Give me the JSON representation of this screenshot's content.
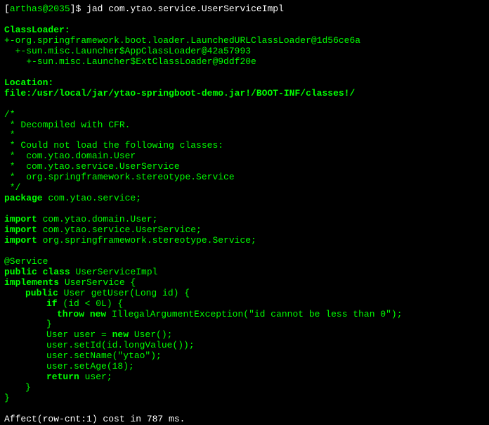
{
  "prompt": {
    "bracket_open": "[",
    "user_host": "arthas@2035",
    "bracket_close": "]$ ",
    "command": "jad com.ytao.service.UserServiceImpl"
  },
  "classloader": {
    "header": "ClassLoader:",
    "line1": "+-org.springframework.boot.loader.LaunchedURLClassLoader@1d56ce6a",
    "line2": "  +-sun.misc.Launcher$AppClassLoader@42a57993",
    "line3": "    +-sun.misc.Launcher$ExtClassLoader@9ddf20e"
  },
  "location": {
    "header": "Location:",
    "path": "file:/usr/local/jar/ytao-springboot-demo.jar!/BOOT-INF/classes!/"
  },
  "comment": {
    "l1": "/*",
    "l2": " * Decompiled with CFR.",
    "l3": " *",
    "l4": " * Could not load the following classes:",
    "l5": " *  com.ytao.domain.User",
    "l6": " *  com.ytao.service.UserService",
    "l7": " *  org.springframework.stereotype.Service",
    "l8": " */"
  },
  "keywords": {
    "package": "package",
    "import": "import",
    "public": "public",
    "class": "class",
    "implements": "implements",
    "if": "if",
    "throw": "throw",
    "new": "new",
    "return": "return"
  },
  "code": {
    "package_name": " com.ytao.service;",
    "import1": " com.ytao.domain.User;",
    "import2": " com.ytao.service.UserService;",
    "import3": " org.springframework.stereotype.Service;",
    "annotation": "@Service",
    "class_name": " UserServiceImpl",
    "implements_name": " UserService {",
    "method_sig": " User getUser(Long id) {",
    "if_cond": " (id < 0L) {",
    "throw_part1": " ",
    "throw_part2": " IllegalArgumentException(\"id cannot be less than 0\");",
    "close_brace": "}",
    "user_decl1": "User user = ",
    "user_decl2": " User();",
    "set_id": "user.setId(id.longValue());",
    "set_name": "user.setName(\"ytao\");",
    "set_age": "user.setAge(18);",
    "return_val": " user;"
  },
  "footer": "Affect(row-cnt:1) cost in 787 ms."
}
